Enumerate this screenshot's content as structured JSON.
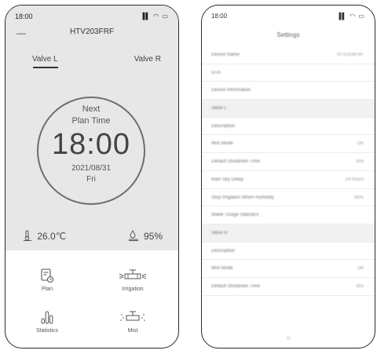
{
  "left_screen": {
    "status_time": "18:00",
    "status_icons": "▐▌ ◠ ▭",
    "back_symbol": "—",
    "device_title": "HTV203FRF",
    "tabs": [
      "Valve L",
      "Valve R"
    ],
    "active_tab": "Valve L",
    "next_label": "Next",
    "plan_time_label": "Plan Time",
    "plan_time": "18:00",
    "plan_date": "2021/08/31",
    "plan_day": "Fri",
    "temperature": "26.0℃",
    "humidity": "95%",
    "tiles": {
      "plan": "Plan",
      "irrigation": "Irrigation",
      "statistics": "Statistics",
      "mist": "Mist"
    }
  },
  "right_screen": {
    "status_time": "18:00",
    "status_icons": "▐▌ ◠ ▭",
    "title": "Settings",
    "rows": [
      {
        "label": "Device Name",
        "value": "HTV203FRF",
        "section": false
      },
      {
        "label": "OTA",
        "value": "",
        "section": false
      },
      {
        "label": "Device Information",
        "value": "",
        "section": false
      },
      {
        "label": "Valve L",
        "value": "",
        "section": true
      },
      {
        "label": "Description",
        "value": "",
        "section": false
      },
      {
        "label": "Mist Mode",
        "value": "On",
        "section": false
      },
      {
        "label": "Default Shutdown Time",
        "value": "30s",
        "section": false
      },
      {
        "label": "Rain Sky Delay",
        "value": "24 hours",
        "section": false
      },
      {
        "label": "Stop Irrigation When Humidity",
        "value": "95%",
        "section": false
      },
      {
        "label": "Water Usage Statistics",
        "value": "",
        "section": false
      },
      {
        "label": "Valve R",
        "value": "",
        "section": true
      },
      {
        "label": "Description",
        "value": "",
        "section": false
      },
      {
        "label": "Mist Mode",
        "value": "On",
        "section": false
      },
      {
        "label": "Default Shutdown Time",
        "value": "30s",
        "section": false
      }
    ]
  }
}
